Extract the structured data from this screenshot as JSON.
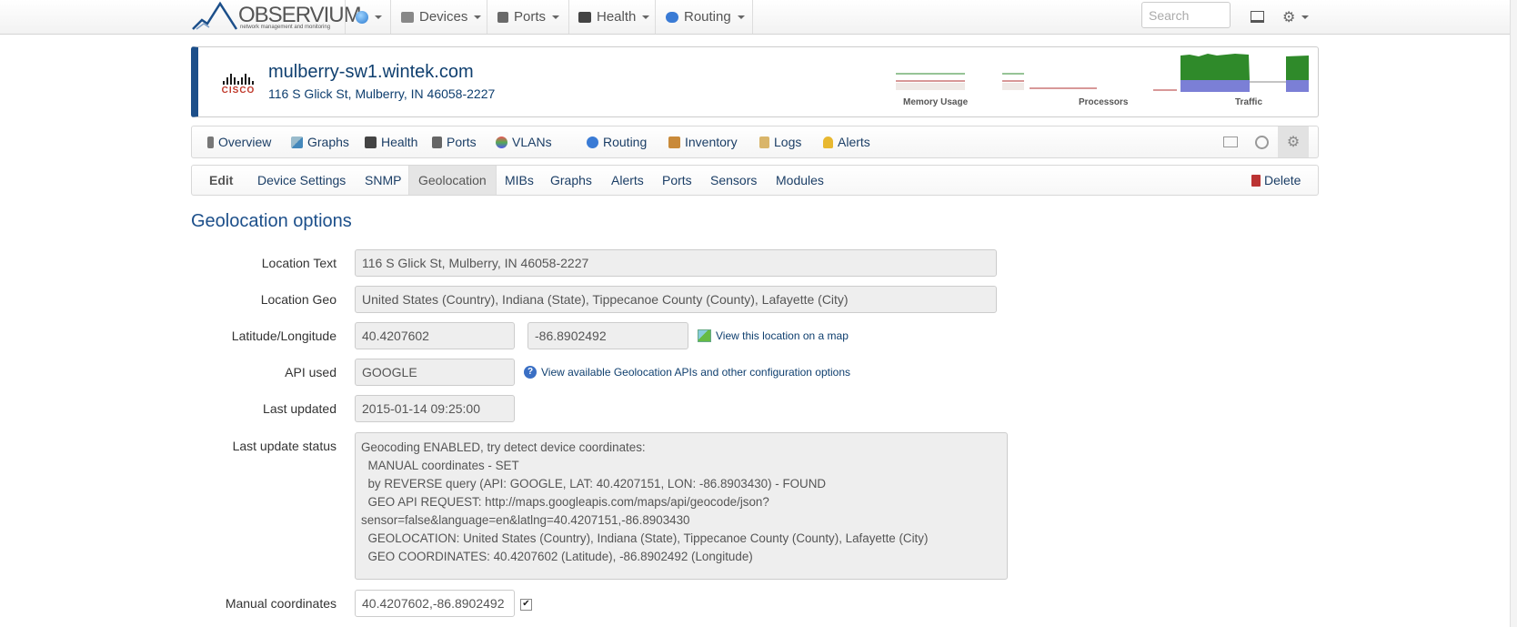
{
  "topbar": {
    "logo_text": "OBSERVIUM",
    "logo_tagline": "network management and monitoring",
    "nav": [
      {
        "label": "Devices"
      },
      {
        "label": "Ports"
      },
      {
        "label": "Health"
      },
      {
        "label": "Routing"
      }
    ],
    "search_placeholder": "Search"
  },
  "device": {
    "vendor": "CISCO",
    "hostname": "mulberry-sw1.wintek.com",
    "address": "116 S Glick St, Mulberry, IN 46058-2227",
    "sparklines": [
      {
        "label": "Memory Usage"
      },
      {
        "label": "Processors"
      },
      {
        "label": "Traffic"
      }
    ]
  },
  "device_tabs": [
    "Overview",
    "Graphs",
    "Health",
    "Ports",
    "VLANs",
    "Routing",
    "Inventory",
    "Logs",
    "Alerts"
  ],
  "edit_tabs": {
    "items": [
      "Edit",
      "Device Settings",
      "SNMP",
      "Geolocation",
      "MIBs",
      "Graphs",
      "Alerts",
      "Ports",
      "Sensors",
      "Modules"
    ],
    "active": "Geolocation",
    "delete_label": "Delete"
  },
  "form": {
    "title": "Geolocation options",
    "location_text_label": "Location Text",
    "location_text": "116 S Glick St, Mulberry, IN 46058-2227",
    "location_geo_label": "Location Geo",
    "location_geo": "United States (Country), Indiana (State), Tippecanoe County (County), Lafayette (City)",
    "latlon_label": "Latitude/Longitude",
    "latitude": "40.4207602",
    "longitude": "-86.8902492",
    "map_link": "View this location on a map",
    "api_label": "API used",
    "api": "GOOGLE",
    "api_link": "View available Geolocation APIs and other configuration options",
    "last_updated_label": "Last updated",
    "last_updated": "2015-01-14 09:25:00",
    "status_label": "Last update status",
    "status": "Geocoding ENABLED, try detect device coordinates:\n  MANUAL coordinates - SET\n  by REVERSE query (API: GOOGLE, LAT: 40.4207151, LON: -86.8903430) - FOUND\n  GEO API REQUEST: http://maps.googleapis.com/maps/api/geocode/json?sensor=false&language=en&latlng=40.4207151,-86.8903430\n  GEOLOCATION: United States (Country), Indiana (State), Tippecanoe County (County), Lafayette (City)\n  GEO COORDINATES: 40.4207602 (Latitude), -86.8902492 (Longitude)",
    "manual_label": "Manual coordinates",
    "manual_value": "40.4207602,-86.8902492",
    "manual_checked": true
  },
  "colors": {
    "brand": "#1c4f8a",
    "link": "#0f3f6f",
    "traffic_in": "#3e8e2e",
    "traffic_out": "#7b7fd6"
  }
}
